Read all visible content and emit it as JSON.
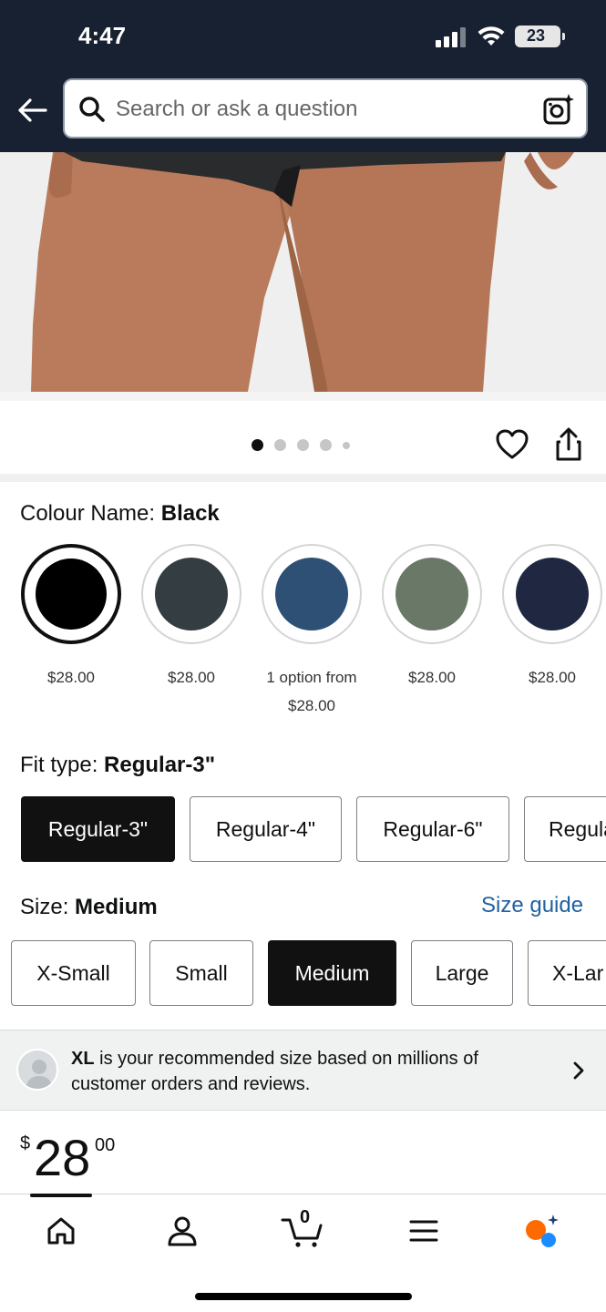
{
  "status_bar": {
    "time": "4:47",
    "battery": "23"
  },
  "search": {
    "placeholder": "Search or ask a question"
  },
  "gallery": {
    "dot_count": 5,
    "active_index": 0
  },
  "colour": {
    "label": "Colour Name: ",
    "value": "Black",
    "swatches": [
      {
        "color": "#000000",
        "price_line1": "$28.00",
        "price_line2": "",
        "selected": true
      },
      {
        "color": "#343d41",
        "price_line1": "$28.00",
        "price_line2": "",
        "selected": false
      },
      {
        "color": "#2e5075",
        "price_line1": "1 option from",
        "price_line2": "$28.00",
        "selected": false
      },
      {
        "color": "#6a7868",
        "price_line1": "$28.00",
        "price_line2": "",
        "selected": false
      },
      {
        "color": "#1f2840",
        "price_line1": "$28.00",
        "price_line2": "",
        "selected": false
      }
    ]
  },
  "fit": {
    "label": "Fit type: ",
    "value": "Regular-3\"",
    "options": [
      "Regular-3\"",
      "Regular-4\"",
      "Regular-6\"",
      "Regula"
    ]
  },
  "size": {
    "label": "Size: ",
    "value": "Medium",
    "guide_link": "Size guide",
    "options": [
      "X-Small",
      "Small",
      "Medium",
      "Large",
      "X-Lar"
    ]
  },
  "recommendation": {
    "size": "XL",
    "text": " is your recommended size based on millions of customer orders and reviews."
  },
  "price": {
    "symbol": "$",
    "whole": "28",
    "fraction": "00"
  },
  "cart": {
    "count": "0"
  },
  "colors": {
    "header_bg": "#172132",
    "link": "#2162a1",
    "selected": "#111111",
    "assistant_orange": "#ff6a00",
    "assistant_blue": "#1a8cff"
  }
}
